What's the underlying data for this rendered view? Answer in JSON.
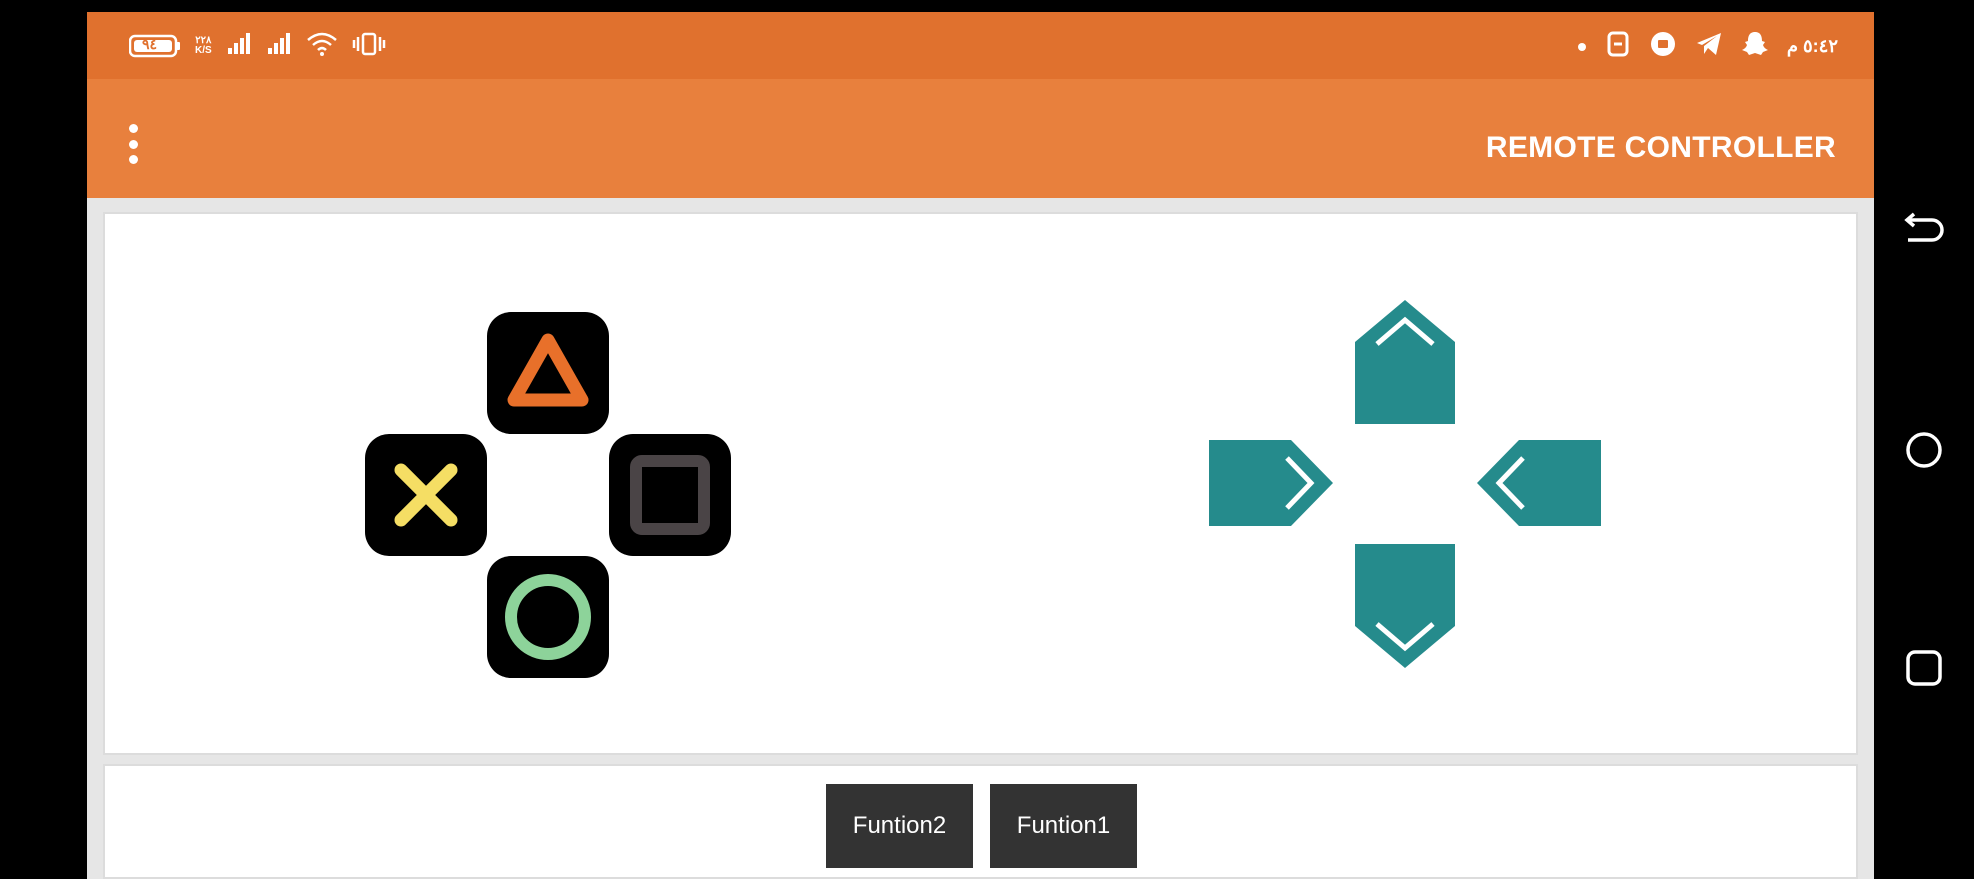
{
  "status_bar": {
    "battery": "٩٤",
    "net_speed": "٢٢٨\nK/S",
    "time": "٥:٤٢ م",
    "icons": [
      "battery-icon",
      "net-speed-icon",
      "signal-icon",
      "signal-icon",
      "wifi-icon",
      "vibrate-icon",
      "dot-icon",
      "app-icon",
      "circle-app-icon",
      "telegram-icon",
      "snapchat-icon"
    ]
  },
  "app_bar": {
    "title": "REMOTE CONTROLLER",
    "menu_icon": "overflow-menu-icon"
  },
  "face_buttons": {
    "triangle": "triangle-button",
    "cross": "cross-button",
    "square": "square-button",
    "circle": "circle-button",
    "colors": {
      "triangle": "#e8702a",
      "cross": "#f5de64",
      "square": "#4a4446",
      "circle": "#8dd39a"
    }
  },
  "dpad": {
    "color": "#258b8c",
    "up": "up-arrow-button",
    "down": "down-arrow-button",
    "left": "left-arrow-button",
    "right": "right-arrow-button"
  },
  "functions": {
    "function2_label": "Funtion2",
    "function1_label": "Funtion1"
  },
  "navigation": {
    "icons": [
      "back-icon",
      "home-icon",
      "recents-icon"
    ]
  },
  "colors": {
    "status_bar": "#e0712e",
    "app_bar": "#e8803d"
  }
}
